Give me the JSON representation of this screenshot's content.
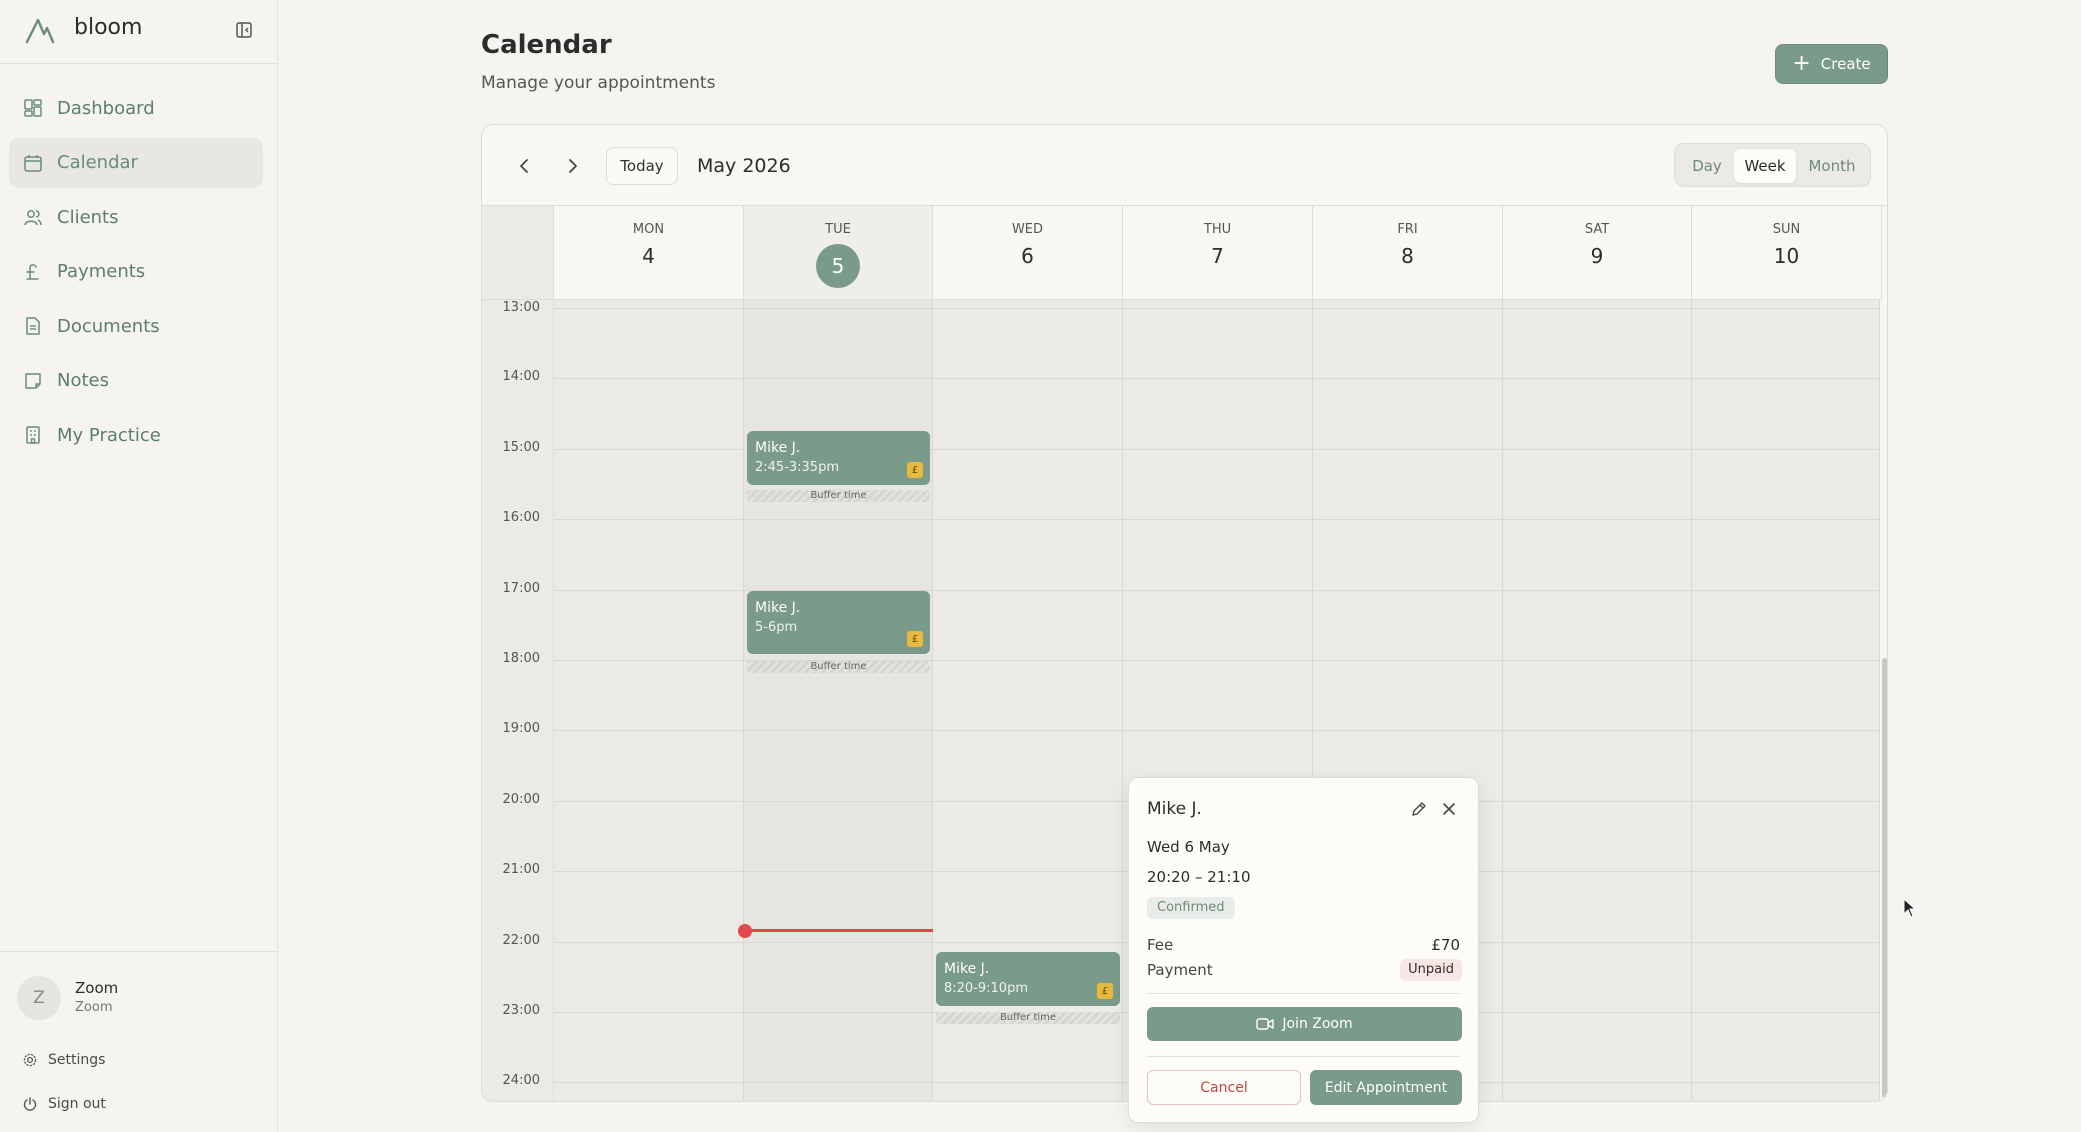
{
  "brand": {
    "name": "bloom"
  },
  "sidebar": {
    "items": [
      {
        "label": "Dashboard",
        "icon": "dashboard-icon",
        "active": false
      },
      {
        "label": "Calendar",
        "icon": "calendar-icon",
        "active": true
      },
      {
        "label": "Clients",
        "icon": "users-icon",
        "active": false
      },
      {
        "label": "Payments",
        "icon": "pound-icon",
        "active": false
      },
      {
        "label": "Documents",
        "icon": "document-icon",
        "active": false
      },
      {
        "label": "Notes",
        "icon": "note-icon",
        "active": false
      },
      {
        "label": "My Practice",
        "icon": "building-icon",
        "active": false
      }
    ],
    "user": {
      "initial": "Z",
      "name": "Zoom",
      "sub": "Zoom"
    },
    "settings_label": "Settings",
    "signout_label": "Sign out"
  },
  "header": {
    "title": "Calendar",
    "subtitle": "Manage your appointments",
    "create_label": "Create"
  },
  "calendar": {
    "today_label": "Today",
    "month_label": "May 2026",
    "views": [
      "Day",
      "Week",
      "Month"
    ],
    "active_view": "Week",
    "days": [
      {
        "dow": "MON",
        "num": "4",
        "today": false
      },
      {
        "dow": "TUE",
        "num": "5",
        "today": true
      },
      {
        "dow": "WED",
        "num": "6",
        "today": false
      },
      {
        "dow": "THU",
        "num": "7",
        "today": false
      },
      {
        "dow": "FRI",
        "num": "8",
        "today": false
      },
      {
        "dow": "SAT",
        "num": "9",
        "today": false
      },
      {
        "dow": "SUN",
        "num": "10",
        "today": false
      }
    ],
    "hours": [
      "13:00",
      "14:00",
      "15:00",
      "16:00",
      "17:00",
      "18:00",
      "19:00",
      "20:00",
      "21:00",
      "22:00",
      "23:00",
      "24:00"
    ],
    "appointments": [
      {
        "client": "Mike J.",
        "time": "2:45-3:35pm",
        "buffer": "Buffer time",
        "fee_icon": "£"
      },
      {
        "client": "Mike J.",
        "time": "5-6pm",
        "buffer": "Buffer time",
        "fee_icon": "£"
      },
      {
        "client": "Mike J.",
        "time": "8:20-9:10pm",
        "buffer": "Buffer time",
        "fee_icon": "£"
      }
    ],
    "colors": {
      "accent": "#7a9a8a",
      "now_line": "#e04a4a",
      "fee_badge": "#e7b93c"
    }
  },
  "popover": {
    "client": "Mike J.",
    "date": "Wed 6 May",
    "time": "20:20 – 21:10",
    "status": "Confirmed",
    "fee_label": "Fee",
    "fee_value": "£70",
    "payment_label": "Payment",
    "payment_value": "Unpaid",
    "join_label": "Join Zoom",
    "cancel_label": "Cancel",
    "edit_label": "Edit Appointment"
  }
}
